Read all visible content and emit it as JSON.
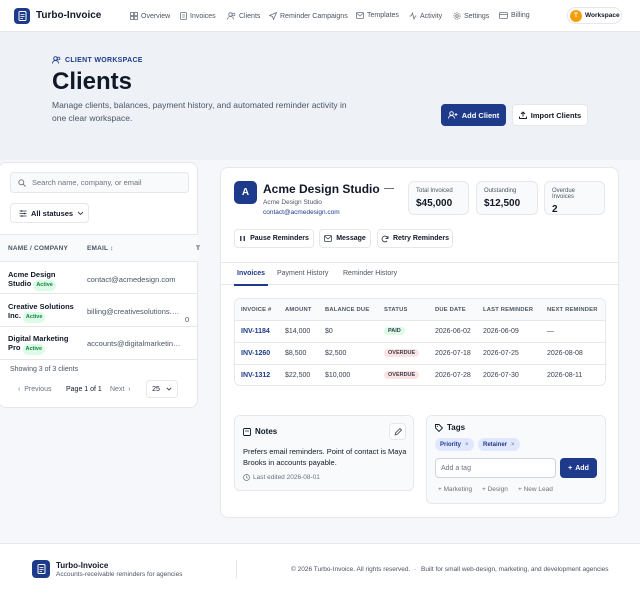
{
  "app": {
    "name": "Turbo-Invoice"
  },
  "nav": [
    {
      "label": "Overview",
      "icon": "grid-icon"
    },
    {
      "label": "Invoices",
      "icon": "file-icon"
    },
    {
      "label": "Clients",
      "icon": "users-icon"
    },
    {
      "label": "Reminder Campaigns",
      "icon": "send-icon"
    },
    {
      "label": "Templates",
      "icon": "mail-icon"
    },
    {
      "label": "Activity",
      "icon": "activity-icon"
    },
    {
      "label": "Settings",
      "icon": "gear-icon"
    },
    {
      "label": "Billing",
      "icon": "card-icon"
    }
  ],
  "workspace": {
    "label": "Workspace",
    "initial": "T"
  },
  "hero": {
    "eyebrow": "CLIENT WORKSPACE",
    "title": "Clients",
    "description": "Manage clients, balances, payment history, and automated reminder activity in one clear workspace.",
    "add_label": "Add Client",
    "import_label": "Import Clients"
  },
  "list": {
    "search_placeholder": "Search name, company, or email",
    "status_filter": "All statuses",
    "columns": {
      "name": "NAME / COMPANY",
      "email": "EMAIL",
      "extra": "T"
    },
    "rows": [
      {
        "name_l1": "Acme Design",
        "name_l2": "Studio",
        "status": "Active",
        "email": "contact@acmedesign.com",
        "extra": ""
      },
      {
        "name_l1": "Creative Solutions",
        "name_l2": "Inc.",
        "status": "Active",
        "email": "billing@creativesolutions.com",
        "extra": "0"
      },
      {
        "name_l1": "Digital Marketing",
        "name_l2": "Pro",
        "status": "Active",
        "email": "accounts@digitalmarketing...",
        "extra": ""
      }
    ],
    "showing": "Showing 3 of 3 clients",
    "pagination": {
      "prev": "Previous",
      "page": "Page 1 of 1",
      "next": "Next",
      "page_size": "25"
    }
  },
  "client": {
    "initial": "A",
    "name": "Acme Design Studio",
    "company": "Acme Design Studio",
    "email": "contact@acmedesign.com",
    "stats": [
      {
        "label": "Total Invoiced",
        "value": "$45,000"
      },
      {
        "label": "Outstanding",
        "value": "$12,500"
      },
      {
        "label": "Overdue Invoices",
        "value": "2"
      }
    ],
    "actions": {
      "pause": "Pause Reminders",
      "message": "Message",
      "retry": "Retry Reminders"
    },
    "tabs": [
      "Invoices",
      "Payment History",
      "Reminder History"
    ],
    "invoice_columns": [
      "INVOICE #",
      "AMOUNT",
      "BALANCE DUE",
      "STATUS",
      "DUE DATE",
      "LAST REMINDER",
      "NEXT REMINDER"
    ],
    "invoices": [
      {
        "id": "INV-1184",
        "amount": "$14,000",
        "balance": "$0",
        "status": "PAID",
        "due": "2026-06-02",
        "last": "2026-06-09",
        "next": "—"
      },
      {
        "id": "INV-1260",
        "amount": "$8,500",
        "balance": "$2,500",
        "status": "OVERDUE",
        "due": "2026-07-18",
        "last": "2026-07-25",
        "next": "2026-08-08"
      },
      {
        "id": "INV-1312",
        "amount": "$22,500",
        "balance": "$10,000",
        "status": "OVERDUE",
        "due": "2026-07-28",
        "last": "2026-07-30",
        "next": "2026-08-11"
      }
    ],
    "notes": {
      "title": "Notes",
      "text": "Prefers email reminders. Point of contact is Maya Brooks in accounts payable.",
      "edited": "Last edited 2026-08-01"
    },
    "tags": {
      "title": "Tags",
      "items": [
        "Priority",
        "Retainer"
      ],
      "placeholder": "Add a tag",
      "add_label": "Add",
      "suggestions": [
        "+ Marketing",
        "+ Design",
        "+ New Lead"
      ]
    }
  },
  "footer": {
    "brand": "Turbo-Invoice",
    "tagline": "Accounts-receivable reminders for agencies",
    "copyright": "© 2026 Turbo-Invoice. All rights reserved.",
    "dot": "·",
    "built": "Built for small web-design, marketing, and development agencies"
  },
  "colors": {
    "accent": "#1e3a8a",
    "paid": "#15803d",
    "overdue": "#b91c1c",
    "workspace_avatar": "#f59e0b"
  }
}
